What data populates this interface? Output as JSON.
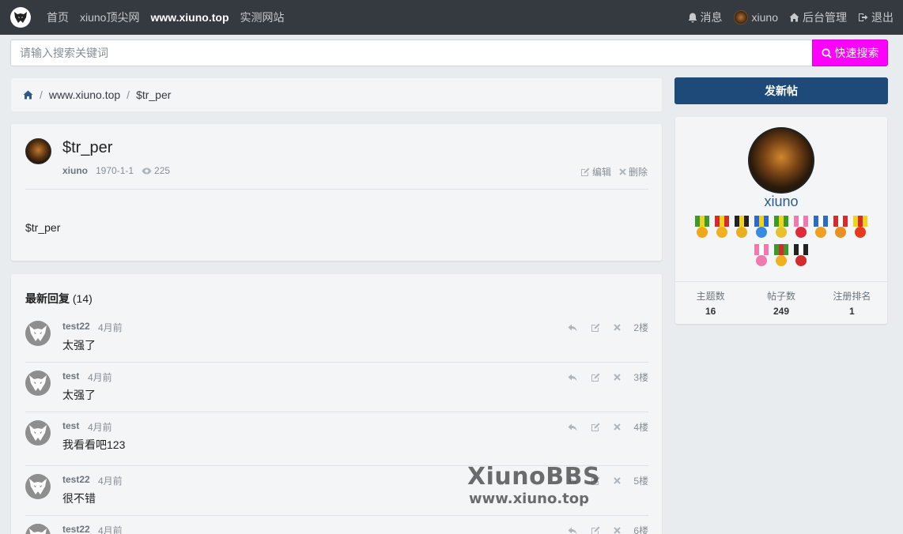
{
  "nav": {
    "links": [
      "首页",
      "xiuno顶尖网",
      "www.xiuno.top",
      "实测网站"
    ],
    "right": {
      "messages": "消息",
      "user": "xiuno",
      "admin": "后台管理",
      "logout": "退出"
    }
  },
  "search": {
    "placeholder": "请输入搜索关键词",
    "button": "快速搜索"
  },
  "breadcrumb": [
    "www.xiuno.top",
    "$tr_per"
  ],
  "post": {
    "title": "$tr_per",
    "author": "xiuno",
    "date": "1970-1-1",
    "views": "225",
    "edit": "编辑",
    "delete": "删除",
    "body": "$tr_per"
  },
  "replies": {
    "heading": "最新回复",
    "count": "(14)",
    "items": [
      {
        "user": "test22",
        "time": "4月前",
        "text": "太强了",
        "floor": "2楼"
      },
      {
        "user": "test",
        "time": "4月前",
        "text": "太强了",
        "floor": "3楼"
      },
      {
        "user": "test",
        "time": "4月前",
        "text": "我看看吧123",
        "floor": "4楼"
      },
      {
        "user": "test22",
        "time": "4月前",
        "text": "很不错",
        "floor": "5楼"
      },
      {
        "user": "test22",
        "time": "4月前",
        "text": "",
        "floor": "6楼"
      }
    ]
  },
  "watermark": {
    "title": "XiunoBBS",
    "url": "www.xiuno.top"
  },
  "sidebar": {
    "new_thread": "发新帖",
    "profile_name": "xiuno",
    "stats": [
      {
        "label": "主题数",
        "value": "16"
      },
      {
        "label": "帖子数",
        "value": "249"
      },
      {
        "label": "注册排名",
        "value": "1"
      }
    ]
  },
  "colors": {
    "navbar": "#343a40",
    "search_button": "#ff00ff",
    "new_thread_button": "#1e4a7a"
  }
}
